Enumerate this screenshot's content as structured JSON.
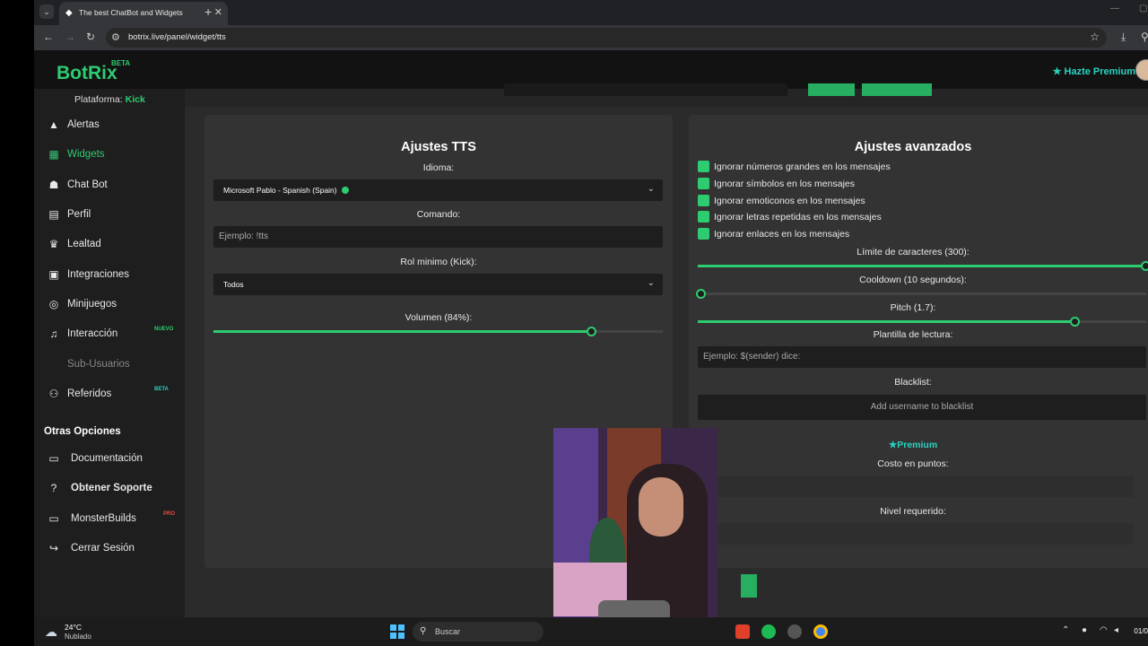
{
  "browser": {
    "tab_title": "The best ChatBot and Widgets",
    "url": "botrix.live/panel/widget/tts"
  },
  "header": {
    "logo": "BotRix",
    "logo_badge": "BETA",
    "premium_link": "Hazte Premium"
  },
  "sidebar": {
    "platform_label": "Plataforma:",
    "platform_value": "Kick",
    "items": [
      {
        "label": "Alertas",
        "icon": "warning-icon"
      },
      {
        "label": "Widgets",
        "icon": "grid-icon"
      },
      {
        "label": "Chat Bot",
        "icon": "robot-icon"
      },
      {
        "label": "Perfil",
        "icon": "id-card-icon"
      },
      {
        "label": "Lealtad",
        "icon": "trophy-icon"
      },
      {
        "label": "Integraciones",
        "icon": "plug-icon"
      },
      {
        "label": "Minijuegos",
        "icon": "gamepad-icon"
      },
      {
        "label": "Interacción",
        "icon": "music-icon",
        "badge": "NUEVO"
      },
      {
        "label": "Sub-Usuarios",
        "icon": "users-icon"
      },
      {
        "label": "Referidos",
        "icon": "users-icon",
        "badge": "BETA"
      }
    ],
    "options_title": "Otras Opciones",
    "options": [
      {
        "label": "Documentación",
        "icon": "book-icon"
      },
      {
        "label": "Obtener Soporte",
        "icon": "help-icon"
      },
      {
        "label": "MonsterBuilds",
        "icon": "monitor-icon",
        "badge": "PRO"
      },
      {
        "label": "Cerrar Sesión",
        "icon": "logout-icon"
      }
    ],
    "colors": {
      "accent": "#2ecc71",
      "badge_new": "#2ecc71",
      "badge_beta": "#29d3c1",
      "badge_pro": "#e74c3c"
    }
  },
  "tts": {
    "title": "Ajustes TTS",
    "language_label": "Idioma:",
    "language_value": "Microsoft Pablo - Spanish (Spain)",
    "command_label": "Comando:",
    "command_placeholder": "Ejemplo: !tts",
    "role_label": "Rol minimo (Kick):",
    "role_value": "Todos",
    "volume_label": "Volumen (84%):",
    "volume_value": 84
  },
  "advanced": {
    "title": "Ajustes avanzados",
    "checks": [
      "Ignorar números grandes en los mensajes",
      "Ignorar símbolos en los mensajes",
      "Ignorar emoticonos en los mensajes",
      "Ignorar letras repetidas en los mensajes",
      "Ignorar enlaces en los mensajes"
    ],
    "char_limit_label": "Límite de caracteres (300):",
    "char_limit_fraction": 1.0,
    "cooldown_label": "Cooldown (10 segundos):",
    "cooldown_fraction": 0.0,
    "pitch_label": "Pitch (1.7):",
    "pitch_fraction": 0.84,
    "template_label": "Plantilla de lectura:",
    "template_placeholder": "Ejemplo: $(sender) dice:",
    "blacklist_label": "Blacklist:",
    "blacklist_placeholder": "Add username to blacklist",
    "premium_title": "Premium",
    "cost_label": "Costo en puntos:",
    "cost_value": "0",
    "level_label": "Nivel requerido:",
    "level_value": "0"
  },
  "taskbar": {
    "temp": "24°C",
    "weather": "Nublado",
    "search_label": "Buscar",
    "clock": "01/0"
  }
}
